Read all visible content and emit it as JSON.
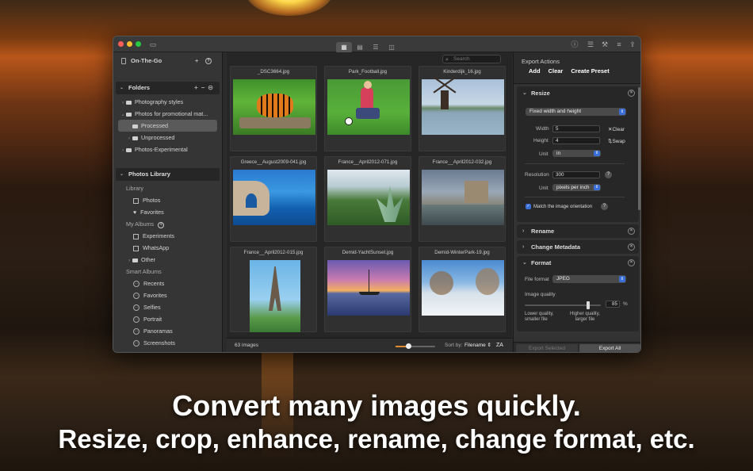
{
  "captions": {
    "line1": "Convert many images quickly.",
    "line2": "Resize, crop, enhance, rename, change format, etc."
  },
  "sidebar": {
    "source": "On-The-Go",
    "folders_title": "Folders",
    "folders": [
      {
        "label": "Photography styles",
        "expanded": false
      },
      {
        "label": "Photos for promotional mat...",
        "expanded": true
      },
      {
        "label": "Processed",
        "selected": true
      },
      {
        "label": "Unprocessed",
        "expanded": false
      },
      {
        "label": "Photos-Experimental",
        "expanded": false
      }
    ],
    "library_title": "Photos Library",
    "library": {
      "label": "Library",
      "items": [
        "Photos",
        "Favorites"
      ]
    },
    "albums": {
      "label": "My Albums",
      "items": [
        "Experiments",
        "WhatsApp",
        "Other"
      ]
    },
    "smart": {
      "label": "Smart Albums",
      "items": [
        "Recents",
        "Favorites",
        "Selfies",
        "Portrait",
        "Panoramas",
        "Screenshots"
      ]
    }
  },
  "grid": {
    "search_placeholder": "Search",
    "images": [
      "_DSC3664.jpg",
      "Park_Football.jpg",
      "Kinderdijk_16.jpg",
      "Greece__August2009-041.jpg",
      "France__April2012-071.jpg",
      "France__April2012-032.jpg",
      "France__April2012-015.jpg",
      "Demid-YachtSunset.jpg",
      "Demid-WinterPark-19.jpg"
    ],
    "count": "63 images",
    "sort_label": "Sort by:",
    "sort_value": "Filename",
    "sort_order": "ZA"
  },
  "export": {
    "title": "Export Actions",
    "add": "Add",
    "clear": "Clear",
    "create_preset": "Create Preset",
    "resize": {
      "title": "Resize",
      "mode": "Fixed width and height",
      "width_label": "Width",
      "width": "5",
      "height_label": "Height",
      "height": "4",
      "unit_label": "Unit",
      "unit": "in",
      "clear": "Clear",
      "swap": "Swap",
      "resolution_label": "Resolution",
      "resolution": "300",
      "res_unit": "pixels per inch",
      "match": "Match the image orientation"
    },
    "rename": "Rename",
    "metadata": "Change Metadata",
    "format": {
      "title": "Format",
      "file_format_label": "File format",
      "file_format": "JPEG",
      "quality_label": "Image quality",
      "quality": "85",
      "quality_unit": "%",
      "quality_fraction": 0.85,
      "lower": "Lower quality, smaller file",
      "higher": "Higher quality, larger file"
    },
    "export_selected": "Export Selected",
    "export_all": "Export All"
  }
}
